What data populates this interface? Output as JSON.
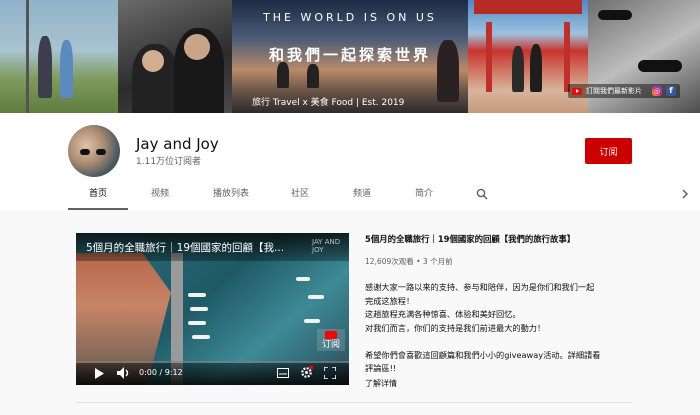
{
  "banner": {
    "tagline": "THE WORLD IS ON US",
    "title": "和我們一起探索世界",
    "subtitle": "旅行 Travel x 美食 Food | Est. 2019",
    "subscribe_link": "訂閱我們最新影片",
    "social_icons": [
      "instagram-icon",
      "facebook-icon"
    ]
  },
  "channel": {
    "name": "Jay and Joy",
    "subscribers": "1.11万位订阅者",
    "subscribe_button": "订阅"
  },
  "tabs": [
    "首页",
    "视频",
    "播放列表",
    "社区",
    "频道",
    "简介"
  ],
  "active_tab": "首页",
  "video": {
    "overlay_title": "5個月的全職旅行｜19個國家的回顧【我...",
    "watermark": "JAY AND JOY",
    "watermark_sub": "订阅",
    "time": "0:00 / 9:12",
    "title": "5個月的全職旅行｜19個國家的回顧【我們的旅行故事】",
    "meta": "12,609次观看 • 3 个月前",
    "description": [
      "感谢大家一路以来的支持、参与和陪伴，因为是你们和我们一起",
      "完成这旅程！",
      "这趟旅程充满各种惊喜、体验和美好回忆。",
      "对我们而言，你们的支持是我们前进最大的動力！",
      "",
      "希望你們會喜歡這回顧篇和我們小小的giveaway活动。詳細請看",
      "評論區!!"
    ],
    "more": "了解详情"
  },
  "colors": {
    "subscribe_red": "#cc0000",
    "background": "#f9f9f9"
  }
}
